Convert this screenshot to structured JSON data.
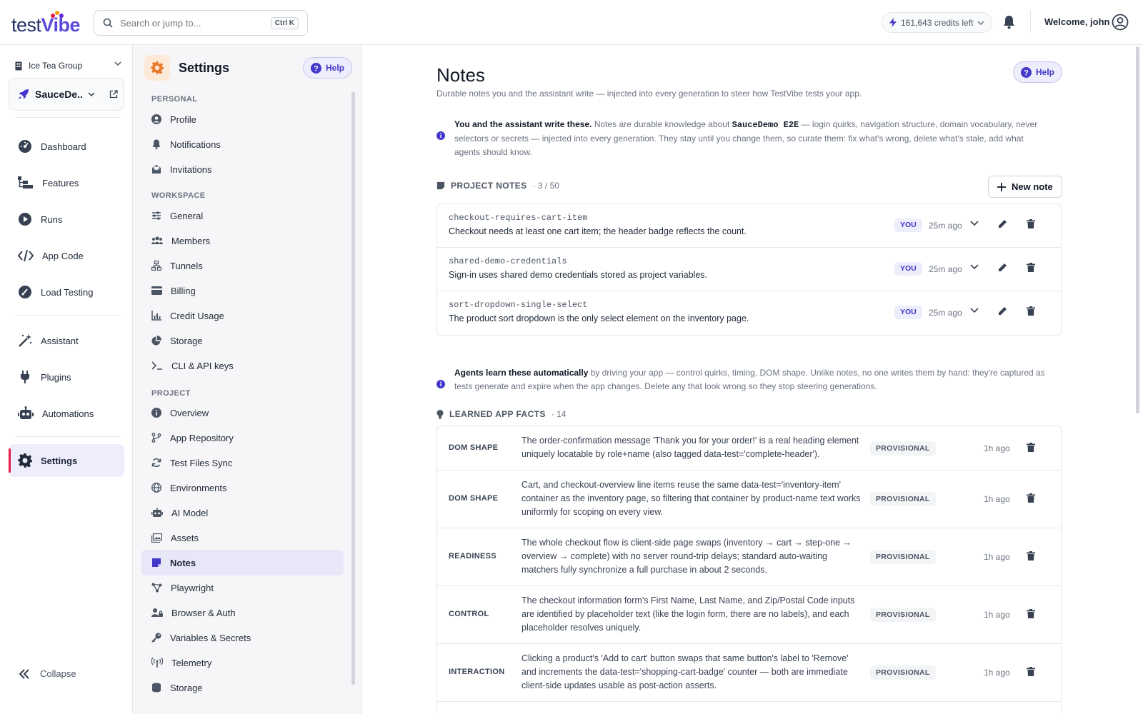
{
  "topbar": {
    "logo_prefix": "test",
    "logo_suffix": "Vibe",
    "search_placeholder": "Search or jump to...",
    "search_shortcut": "Ctrl K",
    "credits": "161,643 credits left",
    "welcome": "Welcome, john"
  },
  "leftnav": {
    "org": "Ice Tea Group",
    "project": "SauceDe...",
    "items": [
      {
        "label": "Dashboard",
        "icon": "gauge-icon"
      },
      {
        "label": "Features",
        "icon": "features-icon"
      },
      {
        "label": "Runs",
        "icon": "play-icon"
      },
      {
        "label": "App Code",
        "icon": "code-icon"
      },
      {
        "label": "Load Testing",
        "icon": "speedometer-icon"
      },
      {
        "label": "Assistant",
        "icon": "magic-wand-icon"
      },
      {
        "label": "Plugins",
        "icon": "plug-icon"
      },
      {
        "label": "Automations",
        "icon": "robot-icon"
      },
      {
        "label": "Settings",
        "icon": "gear-icon",
        "active": true
      }
    ],
    "collapse": "Collapse"
  },
  "settings": {
    "title": "Settings",
    "help": "Help",
    "sections": [
      {
        "title": "PERSONAL",
        "items": [
          "Profile",
          "Notifications",
          "Invitations"
        ]
      },
      {
        "title": "WORKSPACE",
        "items": [
          "General",
          "Members",
          "Tunnels",
          "Billing",
          "Credit Usage",
          "Storage",
          "CLI & API keys"
        ]
      },
      {
        "title": "PROJECT",
        "items": [
          "Overview",
          "App Repository",
          "Test Files Sync",
          "Environments",
          "AI Model",
          "Assets",
          "Notes",
          "Playwright",
          "Browser & Auth",
          "Variables & Secrets",
          "Telemetry",
          "Storage"
        ]
      }
    ],
    "active_item": "Notes"
  },
  "main": {
    "title": "Notes",
    "subtitle": "Durable notes you and the assistant write — injected into every generation to steer how TestVibe tests your app.",
    "help": "Help",
    "callout1": {
      "bold": "You and the assistant write these.",
      "pre": " Notes are durable knowledge about ",
      "project": "SauceDemo E2E",
      "post": " — login quirks, navigation structure, domain vocabulary, never selectors or secrets — injected into every generation. They stay until you change them, so curate them: fix what's wrong, delete what's stale, add what agents should know."
    },
    "project_notes_label": "PROJECT NOTES",
    "project_notes_count": "· 3 / 50",
    "new_note": "New note",
    "notes": [
      {
        "title": "checkout-requires-cart-item",
        "body": "Checkout needs at least one cart item; the header badge reflects the count.",
        "author": "YOU",
        "time": "25m ago"
      },
      {
        "title": "shared-demo-credentials",
        "body": "Sign-in uses shared demo credentials stored as project variables.",
        "author": "YOU",
        "time": "25m ago"
      },
      {
        "title": "sort-dropdown-single-select",
        "body": "The product sort dropdown is the only select element on the inventory page.",
        "author": "YOU",
        "time": "25m ago"
      }
    ],
    "callout2": {
      "bold": "Agents learn these automatically",
      "rest": " by driving your app — control quirks, timing, DOM shape. Unlike notes, no one writes them by hand: they're captured as tests generate and expire when the app changes. Delete any that look wrong so they stop steering generations."
    },
    "facts_label": "LEARNED APP FACTS",
    "facts_count": "· 14",
    "facts": [
      {
        "category": "DOM SHAPE",
        "text": "The order-confirmation message 'Thank you for your order!' is a real heading element uniquely locatable by role+name (also tagged data-test='complete-header').",
        "status": "PROVISIONAL",
        "time": "1h ago"
      },
      {
        "category": "DOM SHAPE",
        "text": "Cart, and checkout-overview line items reuse the same data-test='inventory-item' container as the inventory page, so filtering that container by product-name text works uniformly for scoping on every view.",
        "status": "PROVISIONAL",
        "time": "1h ago"
      },
      {
        "category": "READINESS",
        "text": "The whole checkout flow is client-side page swaps (inventory → cart → step-one → overview → complete) with no server round-trip delays; standard auto-waiting matchers fully synchronize a full purchase in about 2 seconds.",
        "status": "PROVISIONAL",
        "time": "1h ago"
      },
      {
        "category": "CONTROL",
        "text": "The checkout information form's First Name, Last Name, and Zip/Postal Code inputs are identified by placeholder text (like the login form, there are no labels), and each placeholder resolves uniquely.",
        "status": "PROVISIONAL",
        "time": "1h ago"
      },
      {
        "category": "INTERACTION",
        "text": "Clicking a product's 'Add to cart' button swaps that same button's label to 'Remove' and increments the data-test='shopping-cart-badge' counter — both are immediate client-side updates usable as post-action asserts.",
        "status": "PROVISIONAL",
        "time": "1h ago"
      }
    ]
  },
  "colors": {
    "accent": "#4338ca",
    "active_bg": "#ededfb",
    "active_bar": "#e11d48",
    "gear_bg": "#fde9d7"
  }
}
